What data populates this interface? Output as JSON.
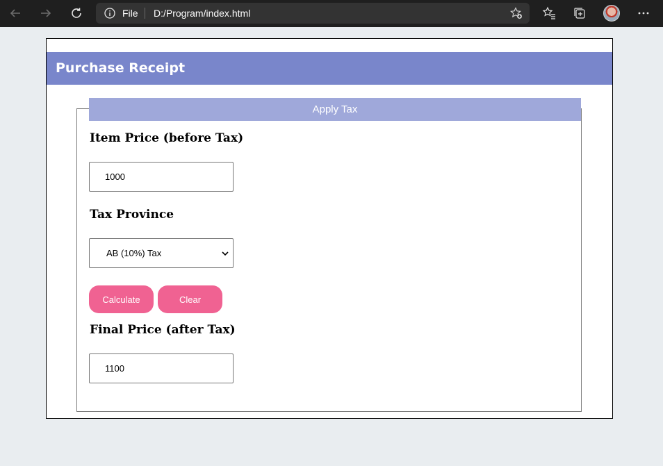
{
  "browser": {
    "file_label": "File",
    "url": "D:/Program/index.html"
  },
  "page": {
    "title": "Purchase Receipt",
    "legend": "Apply Tax",
    "item_price_label": "Item Price (before Tax)",
    "item_price_value": "1000",
    "tax_province_label": "Tax Province",
    "tax_province_selected": "AB (10%) Tax",
    "calculate_label": "Calculate",
    "clear_label": "Clear",
    "final_price_label": "Final Price (after Tax)",
    "final_price_value": "1100"
  },
  "colors": {
    "banner": "#7986cb",
    "legend": "#9fa8da",
    "button": "#f06292"
  }
}
